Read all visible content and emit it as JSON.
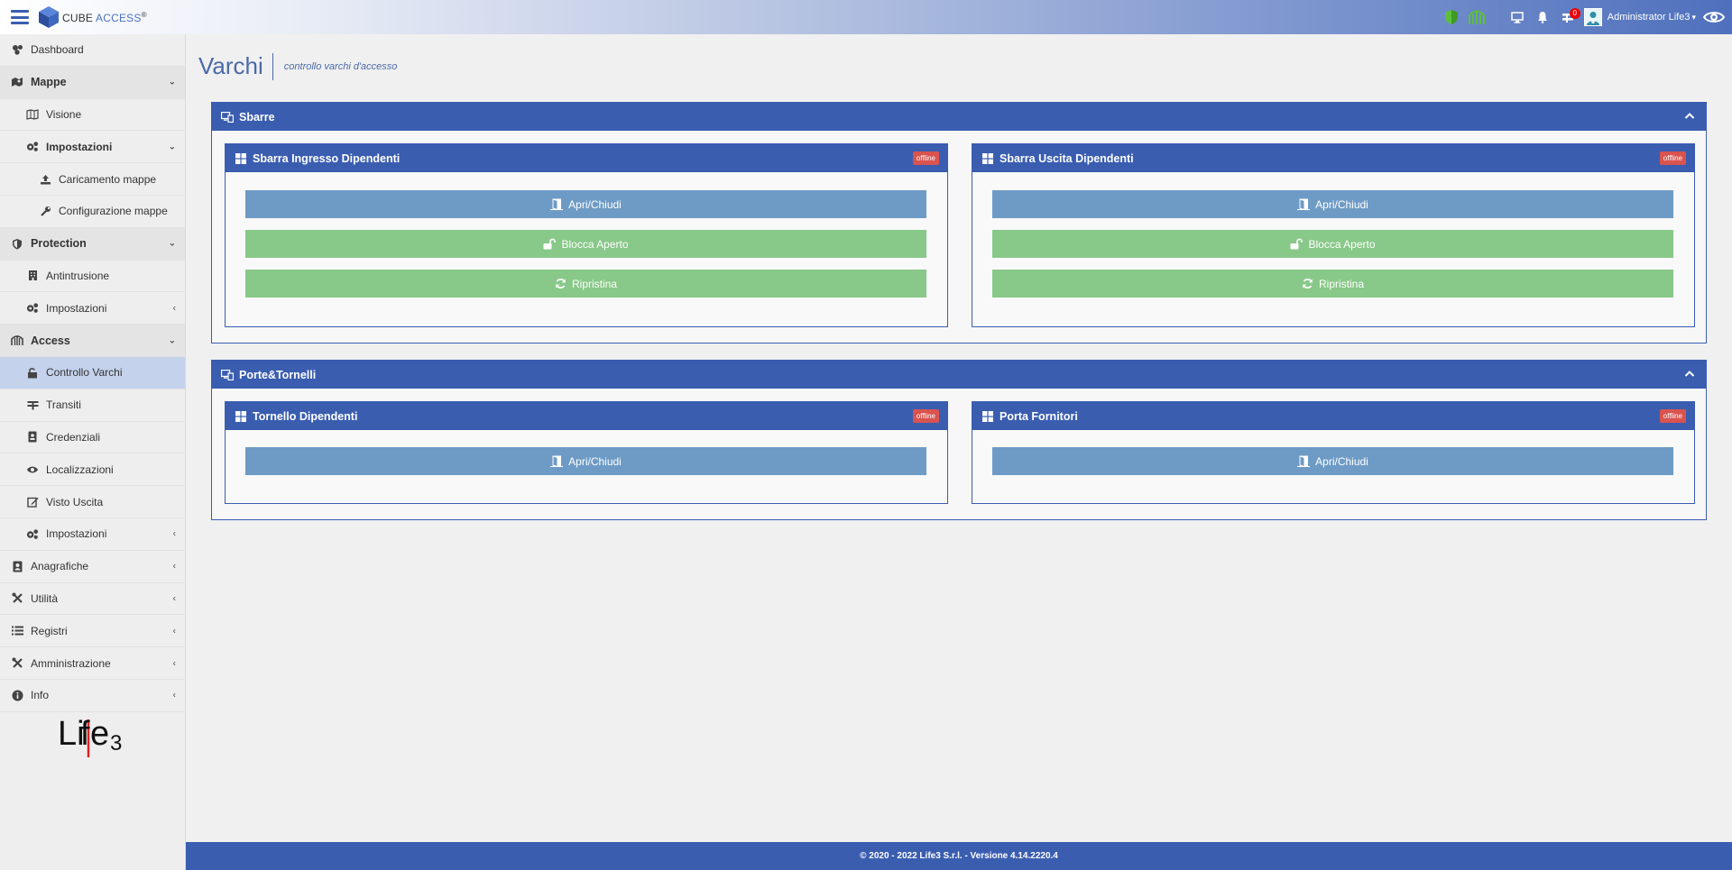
{
  "app": {
    "logo_primary": "CUBE",
    "logo_secondary": "ACCESS",
    "logo_reg": "®"
  },
  "topbar": {
    "user_name": "Administrator Life3",
    "notification_count": "0"
  },
  "sidebar": {
    "items": [
      {
        "label": "Dashboard"
      },
      {
        "label": "Mappe"
      },
      {
        "label": "Visione"
      },
      {
        "label": "Impostazioni"
      },
      {
        "label": "Caricamento mappe"
      },
      {
        "label": "Configurazione mappe"
      },
      {
        "label": "Protection"
      },
      {
        "label": "Antintrusione"
      },
      {
        "label": "Impostazioni"
      },
      {
        "label": "Access"
      },
      {
        "label": "Controllo Varchi"
      },
      {
        "label": "Transiti"
      },
      {
        "label": "Credenziali"
      },
      {
        "label": "Localizzazioni"
      },
      {
        "label": "Visto Uscita"
      },
      {
        "label": "Impostazioni"
      },
      {
        "label": "Anagrafiche"
      },
      {
        "label": "Utilità"
      },
      {
        "label": "Registri"
      },
      {
        "label": "Amministrazione"
      },
      {
        "label": "Info"
      }
    ],
    "brand_logo": "Life3"
  },
  "page": {
    "title": "Varchi",
    "subtitle": "controllo varchi d'accesso"
  },
  "panels": [
    {
      "title": "Sbarre",
      "cards": [
        {
          "title": "Sbarra Ingresso Dipendenti",
          "status": "offline",
          "buttons": [
            "Apri/Chiudi",
            "Blocca Aperto",
            "Ripristina"
          ]
        },
        {
          "title": "Sbarra Uscita Dipendenti",
          "status": "offline",
          "buttons": [
            "Apri/Chiudi",
            "Blocca Aperto",
            "Ripristina"
          ]
        }
      ]
    },
    {
      "title": "Porte&Tornelli",
      "cards": [
        {
          "title": "Tornello Dipendenti",
          "status": "offline",
          "buttons": [
            "Apri/Chiudi"
          ]
        },
        {
          "title": "Porta Fornitori",
          "status": "offline",
          "buttons": [
            "Apri/Chiudi"
          ]
        }
      ]
    }
  ],
  "footer": {
    "text": "© 2020 - 2022 Life3 S.r.l. - Versione 4.14.2220.4"
  },
  "colors": {
    "primary": "#3a5db0",
    "button_blue": "#6e9bc5",
    "button_green": "#88c888",
    "offline_badge": "#d9534f",
    "sidebar_active": "#c4d2ec",
    "shield_green": "#5cbf3b"
  }
}
